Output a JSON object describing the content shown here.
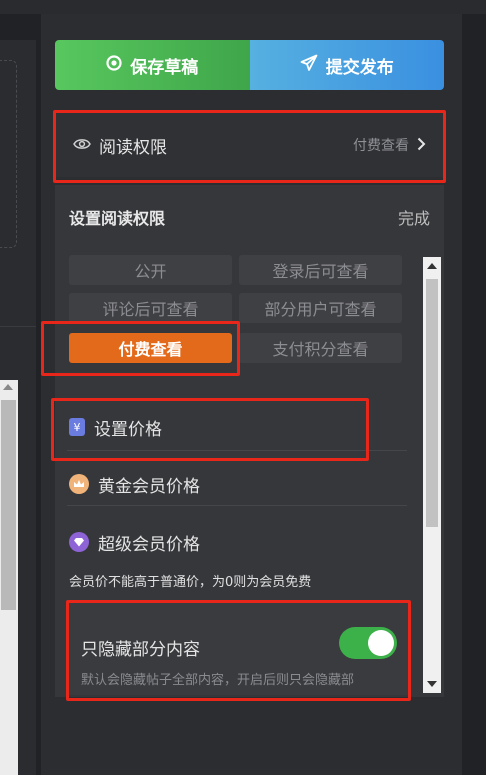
{
  "toolbar": {
    "save_label": "保存草稿",
    "submit_label": "提交发布"
  },
  "reading_permission": {
    "title": "阅读权限",
    "current_value": "付费查看"
  },
  "permission_panel": {
    "heading": "设置阅读权限",
    "done_label": "完成",
    "options": [
      {
        "label": "公开",
        "selected": false
      },
      {
        "label": "登录后可查看",
        "selected": false
      },
      {
        "label": "评论后可查看",
        "selected": false
      },
      {
        "label": "部分用户可查看",
        "selected": false
      },
      {
        "label": "付费查看",
        "selected": true
      },
      {
        "label": "支付积分查看",
        "selected": false
      }
    ]
  },
  "pricing": {
    "set_price": "设置价格",
    "gold_member_price": "黄金会员价格",
    "super_member_price": "超级会员价格",
    "note": "会员价不能高于普通价，为0则为会员免费"
  },
  "hide_partial": {
    "title": "只隐藏部分内容",
    "enabled": true,
    "description": "默认会隐藏帖子全部内容，开启后则只会隐藏部"
  },
  "colors": {
    "accent_orange": "#e36a1b",
    "save_green": "#4cb656",
    "submit_blue": "#3a90e0",
    "toggle_on": "#3cb049",
    "highlight_red": "#e8261a"
  }
}
